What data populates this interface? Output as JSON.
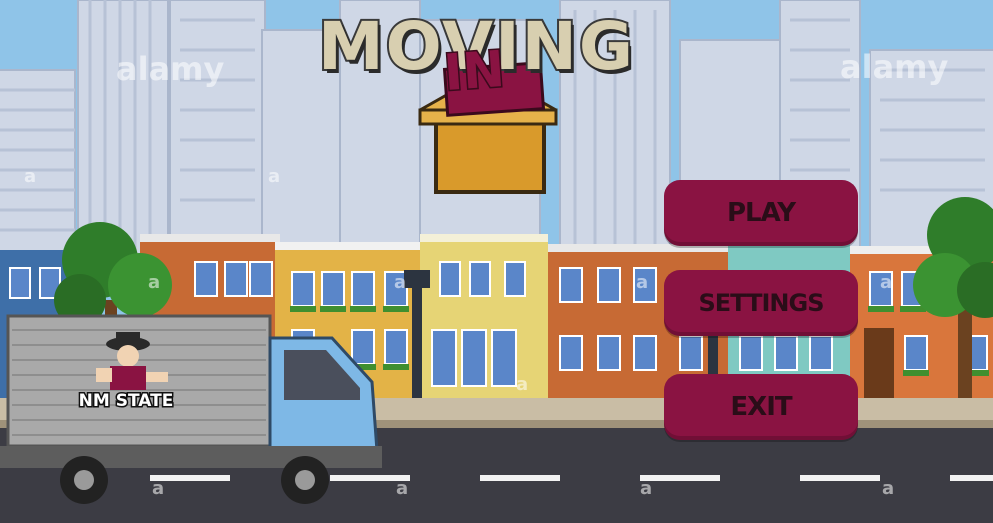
{
  "game": {
    "title_main": "MOVING",
    "title_in": "IN",
    "truck_logo_text": "NM STATE"
  },
  "menu": {
    "play_label": "PLAY",
    "settings_label": "SETTINGS",
    "exit_label": "EXIT"
  },
  "watermark": {
    "text": "alamy",
    "small": "a"
  },
  "colors": {
    "sky": "#8fc4e8",
    "button": "#8a1342",
    "button_text": "#2a0d18",
    "road": "#3c3c44",
    "truck_cab": "#7eb8e6",
    "truck_box": "#a9a9a9",
    "box": "#d99a2b"
  }
}
